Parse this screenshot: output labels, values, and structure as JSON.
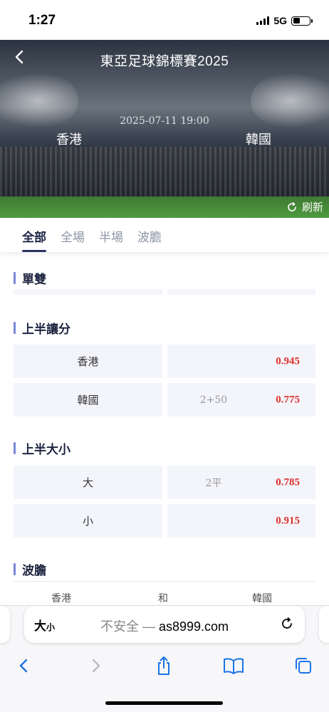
{
  "status": {
    "time": "1:27",
    "network": "5G"
  },
  "header": {
    "title": "東亞足球錦標賽2025",
    "match_time": "2025-07-11 19:00",
    "home_team": "香港",
    "away_team": "韓國",
    "refresh_label": "刷新"
  },
  "tabs": [
    {
      "label": "全部",
      "active": true
    },
    {
      "label": "全場",
      "active": false
    },
    {
      "label": "半場",
      "active": false
    },
    {
      "label": "波膽",
      "active": false
    }
  ],
  "sections": {
    "odd_even": {
      "title": "單雙"
    },
    "first_half_handicap": {
      "title": "上半讓分",
      "rows": [
        {
          "name": "香港",
          "line": "",
          "odds": "0.945"
        },
        {
          "name": "韓國",
          "line": "2+50",
          "odds": "0.775"
        }
      ]
    },
    "first_half_over_under": {
      "title": "上半大小",
      "rows": [
        {
          "name": "大",
          "line": "2平",
          "odds": "0.785"
        },
        {
          "name": "小",
          "line": "",
          "odds": "0.915"
        }
      ]
    },
    "correct_score": {
      "title": "波膽",
      "columns": [
        "香港",
        "和",
        "韓國"
      ]
    }
  },
  "browser": {
    "aa_label": "大",
    "aa_small": "小",
    "insecure_label": "不安全 —",
    "url": "as8999.com"
  },
  "colors": {
    "accent": "#2a3263",
    "section_bar": "#7b86d9",
    "odds": "#e0302c",
    "cell_bg": "#f4f5fb"
  }
}
